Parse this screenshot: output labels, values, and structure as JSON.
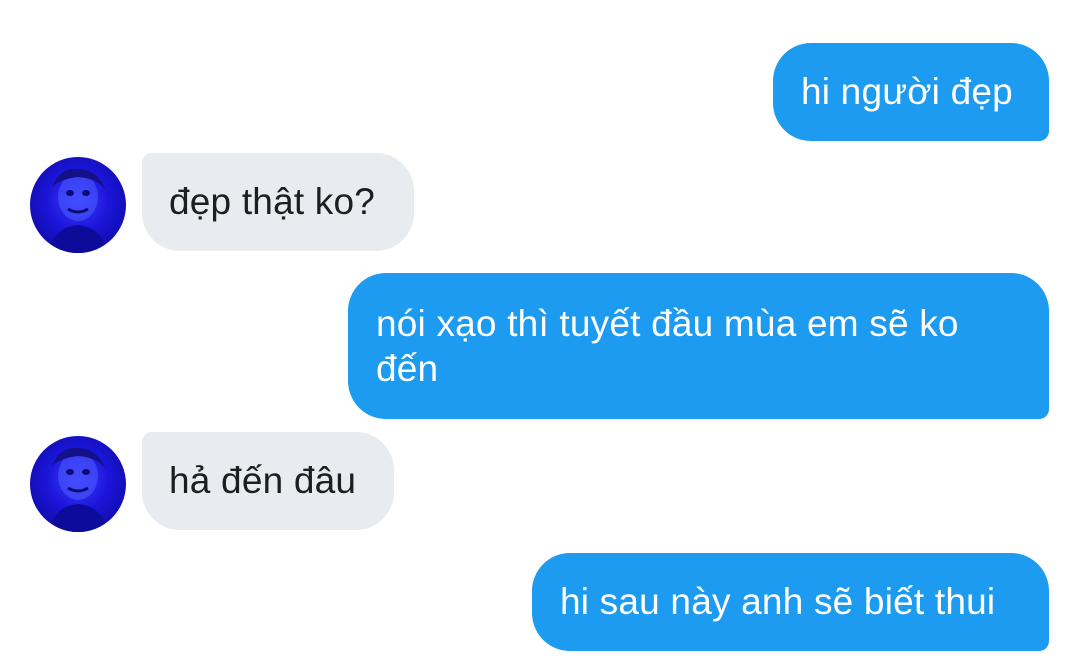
{
  "conversation": {
    "messages": [
      {
        "side": "sent",
        "text": "hi người đẹp"
      },
      {
        "side": "received",
        "text": "đẹp thật ko?"
      },
      {
        "side": "sent",
        "text": "nói xạo thì tuyết đầu mùa em sẽ ko đến"
      },
      {
        "side": "received",
        "text": "hả đến đâu"
      },
      {
        "side": "sent",
        "text": "hi sau này anh sẽ biết thui"
      }
    ]
  },
  "colors": {
    "sent_bubble": "#1d9bf0",
    "received_bubble": "#e8ebef",
    "avatar_tint": "#1a14d8"
  },
  "icons": {
    "avatar": "contact-avatar-icon"
  }
}
